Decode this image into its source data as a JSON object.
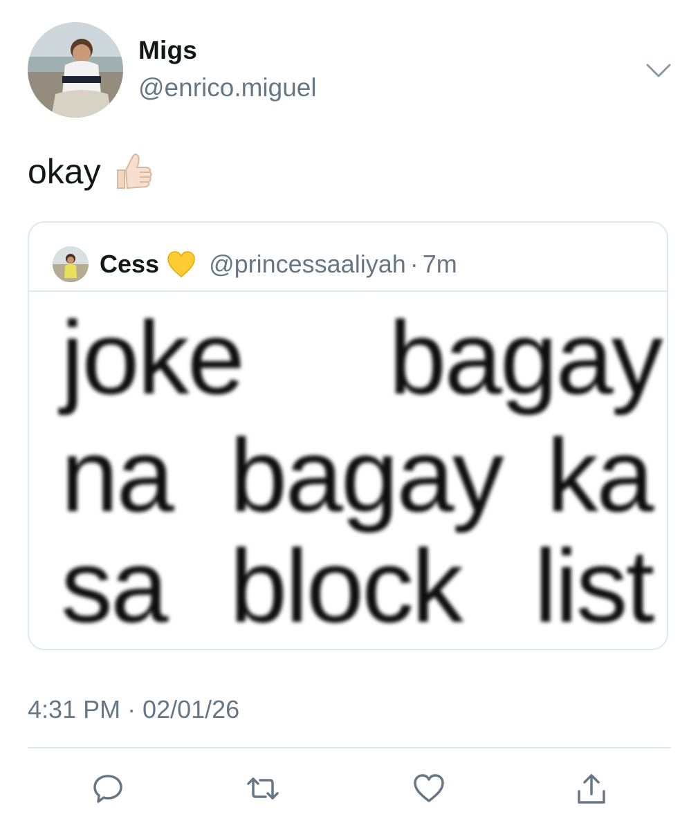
{
  "tweet": {
    "author": {
      "display_name": "Migs",
      "handle": "@enrico.miguel"
    },
    "text": "okay",
    "text_emoji": "thumbs-up-emoji",
    "menu_icon": "chevron-down-icon",
    "quoted": {
      "display_name": "Cess",
      "name_emoji": "yellow-heart-emoji",
      "handle": "@princessaaliyah",
      "separator": "·",
      "time_ago": "7m",
      "media_text": {
        "line1": [
          "joke",
          "bagay"
        ],
        "line2": [
          "na",
          "bagay",
          "ka"
        ],
        "line3": [
          "sa",
          "block",
          "list"
        ]
      }
    },
    "timestamp": "4:31 PM · 02/01/26",
    "actions": [
      {
        "name": "reply",
        "icon": "reply-icon"
      },
      {
        "name": "retweet",
        "icon": "retweet-icon"
      },
      {
        "name": "like",
        "icon": "heart-icon"
      },
      {
        "name": "share",
        "icon": "share-icon"
      }
    ]
  },
  "colors": {
    "text_primary": "#14171a",
    "text_secondary": "#657786",
    "border": "#e1e8ed",
    "icon": "#657786"
  }
}
